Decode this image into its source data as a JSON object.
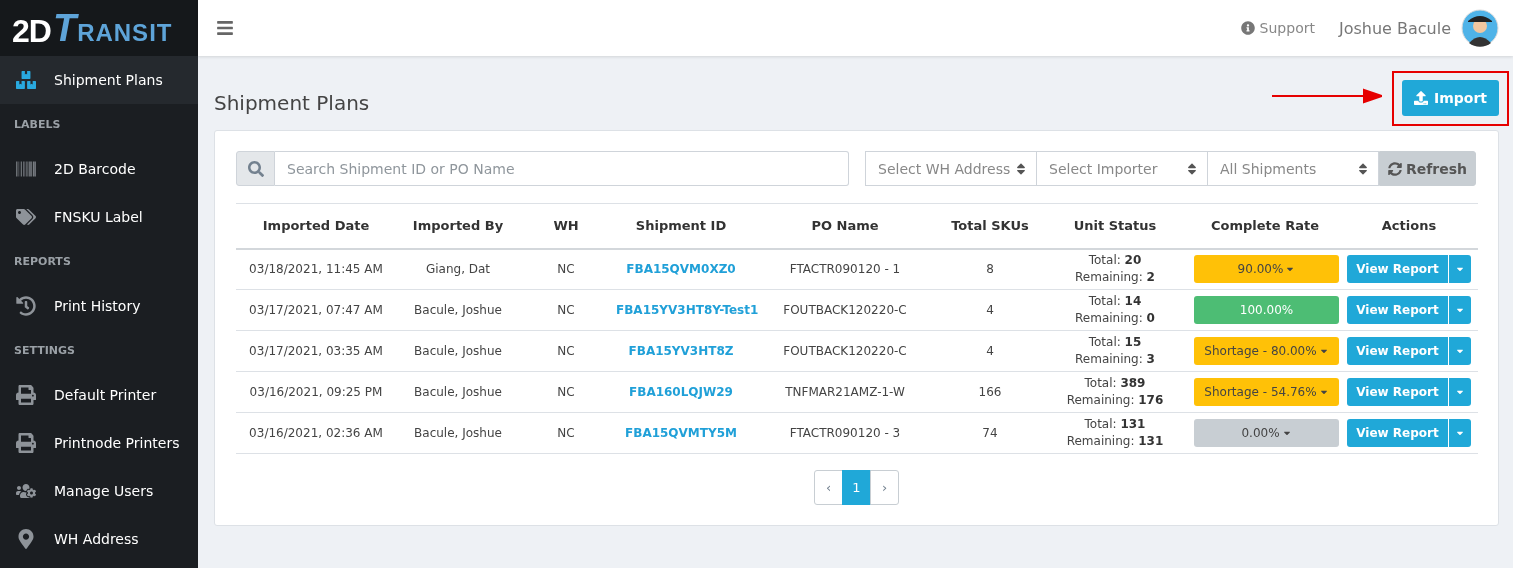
{
  "logo": {
    "prefix": "2D",
    "name": "TRANSIT"
  },
  "sidebar": {
    "items": [
      {
        "label": "Shipment Plans",
        "selected": true
      }
    ],
    "sections": [
      {
        "title": "LABELS",
        "items": [
          {
            "label": "2D Barcode",
            "selected": false
          },
          {
            "label": "FNSKU Label",
            "selected": false
          }
        ]
      },
      {
        "title": "REPORTS",
        "items": [
          {
            "label": "Print History",
            "selected": false
          }
        ]
      },
      {
        "title": "SETTINGS",
        "items": [
          {
            "label": "Default Printer",
            "selected": false
          },
          {
            "label": "Printnode Printers",
            "selected": false
          },
          {
            "label": "Manage Users",
            "selected": false
          },
          {
            "label": "WH Address",
            "selected": false
          }
        ]
      }
    ]
  },
  "header": {
    "support": "Support",
    "user": "Joshue Bacule"
  },
  "page": {
    "title": "Shipment Plans",
    "import_button": "Import"
  },
  "filters": {
    "search_placeholder": "Search Shipment ID or PO Name",
    "selects": [
      "Select WH Address",
      "Select Importer",
      "All Shipments"
    ],
    "refresh": "Refresh"
  },
  "table": {
    "columns": [
      "Imported Date",
      "Imported By",
      "WH",
      "Shipment ID",
      "PO Name",
      "Total SKUs",
      "Unit Status",
      "Complete Rate",
      "Actions"
    ],
    "rows": [
      {
        "imported_date": "03/18/2021, 11:45 AM",
        "imported_by": "Giang, Dat",
        "wh": "NC",
        "shipment_id": "FBA15QVM0XZ0",
        "po_name": "FTACTR090120 - 1",
        "total_skus": "8",
        "total_label": "Total:",
        "total": "20",
        "remaining_label": "Remaining:",
        "remaining": "2",
        "rate": {
          "label": "90.00%",
          "kind": "warning",
          "dropdown": true
        },
        "action": "View Report"
      },
      {
        "imported_date": "03/17/2021, 07:47 AM",
        "imported_by": "Bacule, Joshue",
        "wh": "NC",
        "shipment_id": "FBA15YV3HT8Y-Test1",
        "po_name": "FOUTBACK120220-C",
        "total_skus": "4",
        "total_label": "Total:",
        "total": "14",
        "remaining_label": "Remaining:",
        "remaining": "0",
        "rate": {
          "label": "100.00%",
          "kind": "success",
          "dropdown": false
        },
        "action": "View Report"
      },
      {
        "imported_date": "03/17/2021, 03:35 AM",
        "imported_by": "Bacule, Joshue",
        "wh": "NC",
        "shipment_id": "FBA15YV3HT8Z",
        "po_name": "FOUTBACK120220-C",
        "total_skus": "4",
        "total_label": "Total:",
        "total": "15",
        "remaining_label": "Remaining:",
        "remaining": "3",
        "rate": {
          "label": "Shortage - 80.00%",
          "kind": "warning",
          "dropdown": true
        },
        "action": "View Report"
      },
      {
        "imported_date": "03/16/2021, 09:25 PM",
        "imported_by": "Bacule, Joshue",
        "wh": "NC",
        "shipment_id": "FBA160LQJW29",
        "po_name": "TNFMAR21AMZ-1-W",
        "total_skus": "166",
        "total_label": "Total:",
        "total": "389",
        "remaining_label": "Remaining:",
        "remaining": "176",
        "rate": {
          "label": "Shortage - 54.76%",
          "kind": "warning",
          "dropdown": true
        },
        "action": "View Report"
      },
      {
        "imported_date": "03/16/2021, 02:36 AM",
        "imported_by": "Bacule, Joshue",
        "wh": "NC",
        "shipment_id": "FBA15QVMTY5M",
        "po_name": "FTACTR090120 - 3",
        "total_skus": "74",
        "total_label": "Total:",
        "total": "131",
        "remaining_label": "Remaining:",
        "remaining": "131",
        "rate": {
          "label": "0.00%",
          "kind": "secondary",
          "dropdown": true
        },
        "action": "View Report"
      }
    ]
  },
  "pagination": {
    "prev": "‹",
    "pages": [
      {
        "label": "1",
        "selected": true
      }
    ],
    "next": "›"
  }
}
